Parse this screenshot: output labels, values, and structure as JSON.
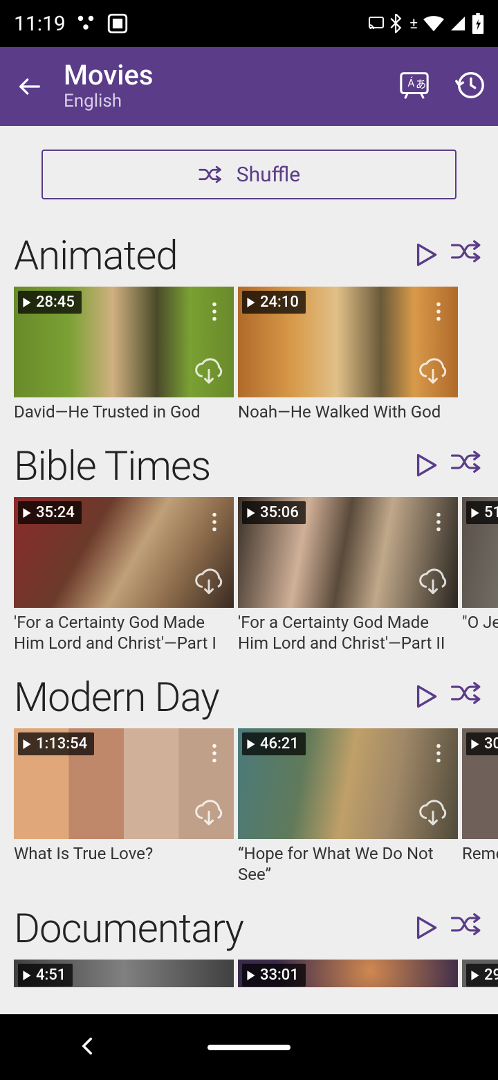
{
  "status": {
    "time": "11:19"
  },
  "header": {
    "title": "Movies",
    "subtitle": "English"
  },
  "shuffle": {
    "label": "Shuffle"
  },
  "sections": {
    "animated": {
      "title": "Animated"
    },
    "bibletimes": {
      "title": "Bible Times"
    },
    "modernday": {
      "title": "Modern Day"
    },
    "documentary": {
      "title": "Documentary"
    }
  },
  "cards": {
    "a1": {
      "dur": "28:45",
      "title": "David—He Trusted in God"
    },
    "a2": {
      "dur": "24:10",
      "title": "Noah—He Walked With God"
    },
    "b1": {
      "dur": "35:24",
      "title": "'For a Certainty God Made Him Lord and Christ'—Part I"
    },
    "b2": {
      "dur": "35:06",
      "title": "'For a Certainty God Made Him Lord and Christ'—Part II"
    },
    "b3": {
      "dur": "51",
      "title": "\"O Jeh"
    },
    "m1": {
      "dur": "1:13:54",
      "title": "What Is True Love?"
    },
    "m2": {
      "dur": "46:21",
      "title": "“Hope for What We Do Not See”"
    },
    "m3": {
      "dur": "30",
      "title": "Reme"
    },
    "d1": {
      "dur": "4:51"
    },
    "d2": {
      "dur": "33:01"
    },
    "d3": {
      "dur": "29"
    }
  }
}
